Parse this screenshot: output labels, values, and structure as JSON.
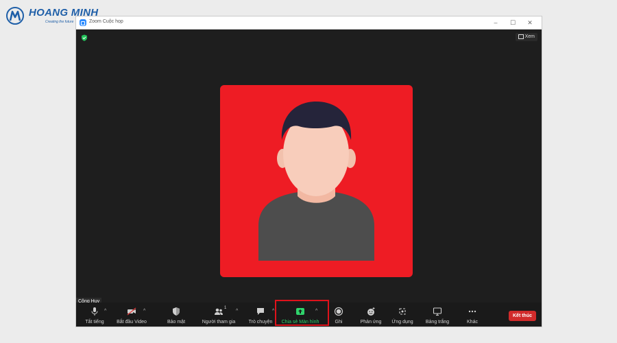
{
  "brand": {
    "name": "HOANG MINH",
    "tagline": "Creating the future",
    "color": "#1f5fa8"
  },
  "window": {
    "title": "Zoom Cuộc họp",
    "controls": [
      "minimize-icon",
      "maximize-icon",
      "close-icon"
    ],
    "view_label": "Xem"
  },
  "participant": {
    "name": "Công Huy",
    "tile_color": "#ee1c24"
  },
  "toolbar": {
    "mute_label": "Tắt tiếng",
    "video_label": "Bắt đầu Video",
    "security_label": "Bảo mật",
    "participants_label": "Người tham gia",
    "participants_count": "1",
    "chat_label": "Trò chuyện",
    "share_label": "Chia sẻ Màn hình",
    "record_label": "Ghi",
    "reactions_label": "Phản ứng",
    "apps_label": "Ứng dụng",
    "whiteboard_label": "Bảng trắng",
    "more_label": "Khác",
    "end_label": "Kết thúc",
    "share_color": "#2fd36b",
    "end_color": "#d12b2b",
    "highlight_color": "#e0121b"
  }
}
